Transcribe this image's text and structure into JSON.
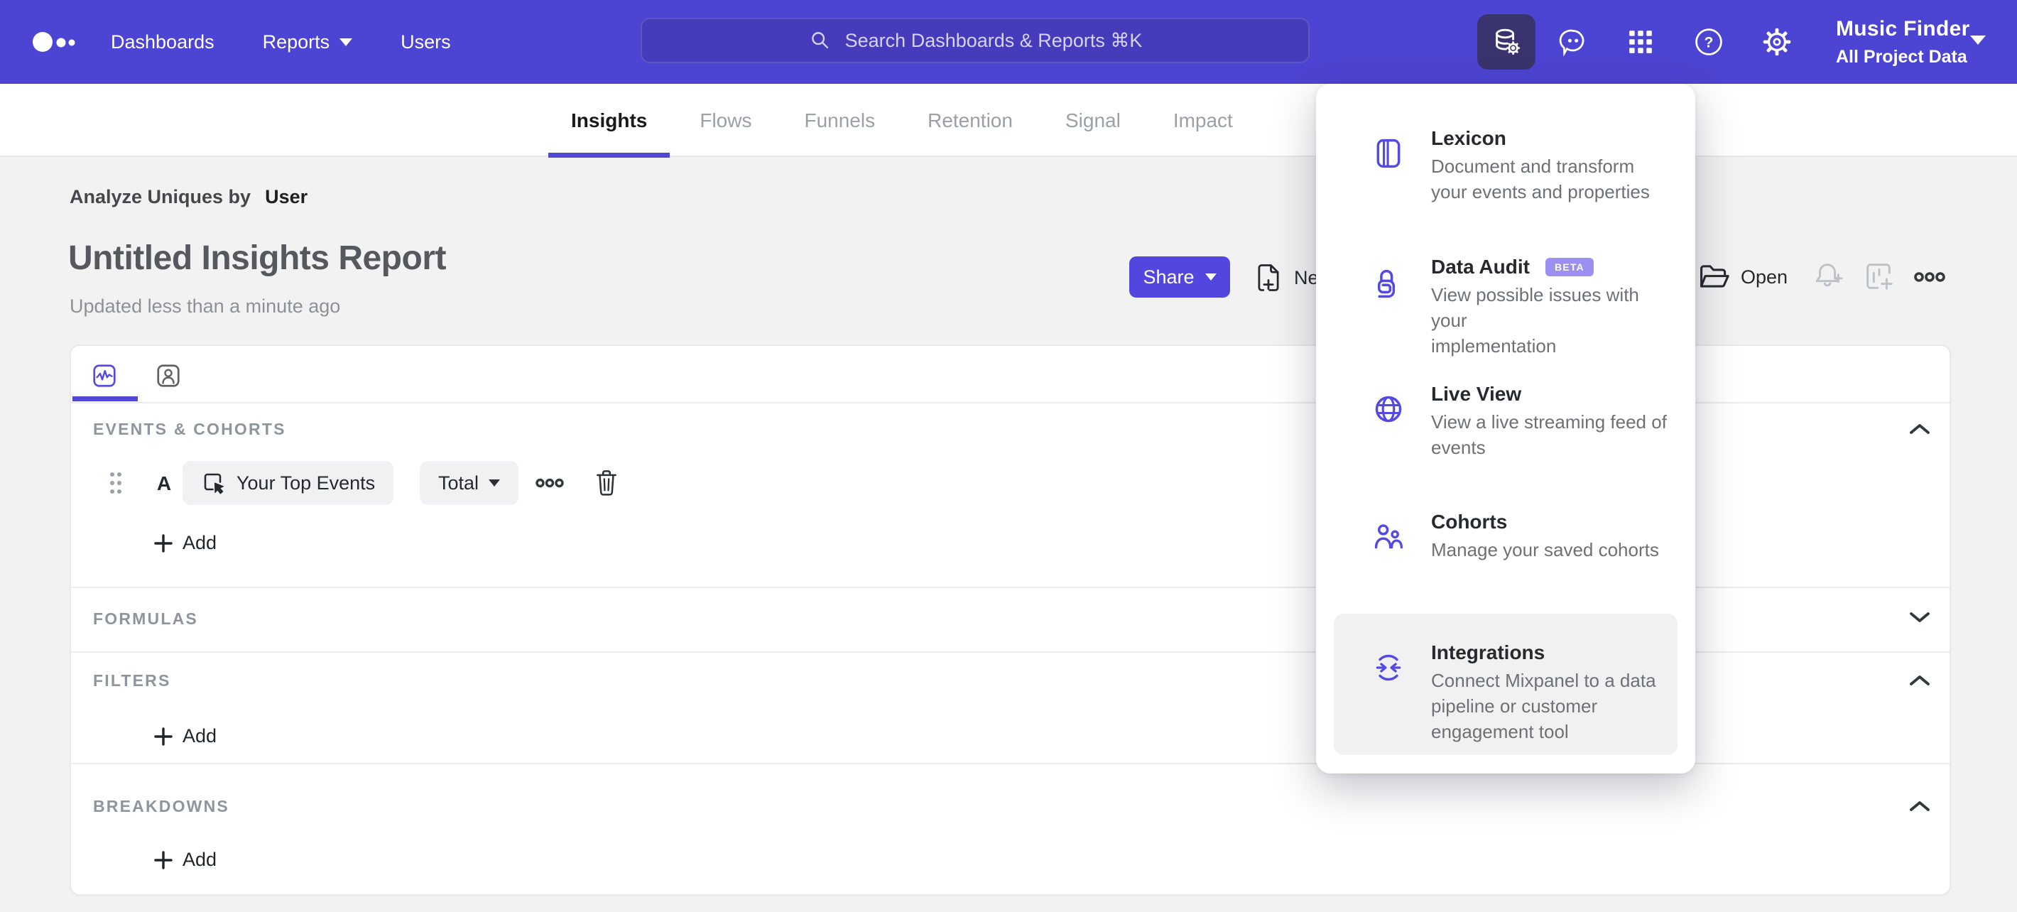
{
  "colors": {
    "nav_bg": "#4c44d2",
    "accent": "#5246de",
    "accent_icon": "#5449e0",
    "active_tile_bg": "#3a346e",
    "page_bg": "#f3f2f2",
    "beta_badge_bg": "#9b8ff0",
    "section_label": "#8f959c",
    "dark_text": "#24292e"
  },
  "icons": {
    "logo": "mixpanel-dots",
    "search": "magnifier",
    "data_management": "database-gear",
    "feedback": "speech-bubble",
    "apps": "grid-3x3",
    "help": "question-circle",
    "settings": "gear",
    "new_report": "document-plus",
    "open": "folder",
    "alert": "bell-plus",
    "board": "chart-plus",
    "more": "ellipsis-circles",
    "insights_tab": "pulse-square",
    "profiles_tab": "person-square",
    "drag": "drag-dots",
    "event": "cursor-click",
    "delete": "trash",
    "collapse": "chevron-up",
    "expand": "chevron-down"
  },
  "nav": {
    "items": [
      {
        "label": "Dashboards",
        "caret": false
      },
      {
        "label": "Reports",
        "caret": true
      },
      {
        "label": "Users",
        "caret": false
      }
    ]
  },
  "search": {
    "placeholder": "Search Dashboards & Reports ⌘K"
  },
  "top_right": {
    "project": {
      "name": "Music Finder",
      "scope": "All Project Data"
    }
  },
  "tabs": {
    "active": "Insights",
    "items": [
      "Insights",
      "Flows",
      "Funnels",
      "Retention",
      "Signal",
      "Impact"
    ]
  },
  "report": {
    "analyze_prefix": "Analyze Uniques by",
    "analyze_value": "User",
    "title": "Untitled Insights Report",
    "updated": "Updated less than a minute ago"
  },
  "toolbar": {
    "share": "Share",
    "new": "New",
    "open": "Open"
  },
  "builder": {
    "sections": {
      "events": "EVENTS & COHORTS",
      "formulas": "FORMULAS",
      "filters": "FILTERS",
      "breakdowns": "BREAKDOWNS"
    },
    "event_row": {
      "letter": "A",
      "event": "Your Top Events",
      "metric": "Total"
    },
    "add_label": "Add"
  },
  "menu": {
    "items": [
      {
        "title": "Lexicon",
        "description": [
          "Document and transform",
          "your events and properties"
        ]
      },
      {
        "title": "Data Audit",
        "badge": "BETA",
        "description": [
          "View possible issues with your",
          "implementation"
        ]
      },
      {
        "title": "Live View",
        "description": [
          "View a live streaming feed of",
          "events"
        ]
      },
      {
        "title": "Cohorts",
        "description": [
          "Manage your saved cohorts"
        ]
      },
      {
        "title": "Integrations",
        "description": [
          "Connect Mixpanel to a data",
          "pipeline or customer",
          "engagement tool"
        ],
        "highlighted": true
      }
    ]
  }
}
